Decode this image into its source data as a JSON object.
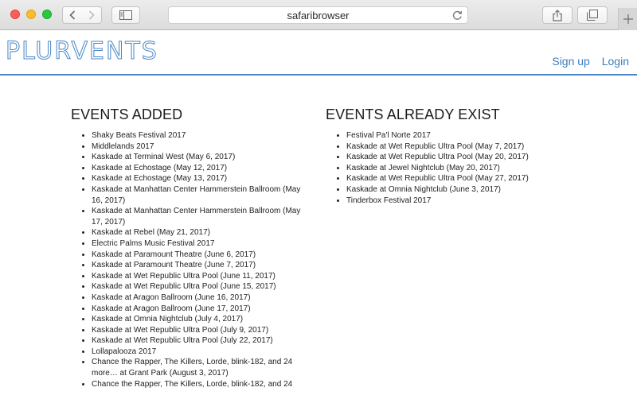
{
  "browser": {
    "url": "safaribrowser"
  },
  "site": {
    "logo": "PLURVENTS",
    "signup_label": "Sign up",
    "login_label": "Login",
    "accent_color": "#4a86c6"
  },
  "added": {
    "heading": "EVENTS ADDED",
    "items": [
      "Shaky Beats Festival 2017",
      "Middlelands 2017",
      "Kaskade at Terminal West (May 6, 2017)",
      "Kaskade at Echostage (May 12, 2017)",
      "Kaskade at Echostage (May 13, 2017)",
      "Kaskade at Manhattan Center Hammerstein Ballroom (May 16, 2017)",
      "Kaskade at Manhattan Center Hammerstein Ballroom (May 17, 2017)",
      "Kaskade at Rebel (May 21, 2017)",
      "Electric Palms Music Festival 2017",
      "Kaskade at Paramount Theatre (June 6, 2017)",
      "Kaskade at Paramount Theatre (June 7, 2017)",
      "Kaskade at Wet Republic Ultra Pool (June 11, 2017)",
      "Kaskade at Wet Republic Ultra Pool (June 15, 2017)",
      "Kaskade at Aragon Ballroom (June 16, 2017)",
      "Kaskade at Aragon Ballroom (June 17, 2017)",
      "Kaskade at Omnia Nightclub (July 4, 2017)",
      "Kaskade at Wet Republic Ultra Pool (July 9, 2017)",
      "Kaskade at Wet Republic Ultra Pool (July 22, 2017)",
      "Lollapalooza 2017",
      "Chance the Rapper, The Killers, Lorde, blink-182, and 24 more… at Grant Park (August 3, 2017)",
      "Chance the Rapper, The Killers, Lorde, blink-182, and 24"
    ]
  },
  "existing": {
    "heading": "EVENTS ALREADY EXIST",
    "items": [
      "Festival Pa'l Norte 2017",
      "Kaskade at Wet Republic Ultra Pool (May 7, 2017)",
      "Kaskade at Wet Republic Ultra Pool (May 20, 2017)",
      "Kaskade at Jewel Nightclub (May 20, 2017)",
      "Kaskade at Wet Republic Ultra Pool (May 27, 2017)",
      "Kaskade at Omnia Nightclub (June 3, 2017)",
      "Tinderbox Festival 2017"
    ]
  }
}
